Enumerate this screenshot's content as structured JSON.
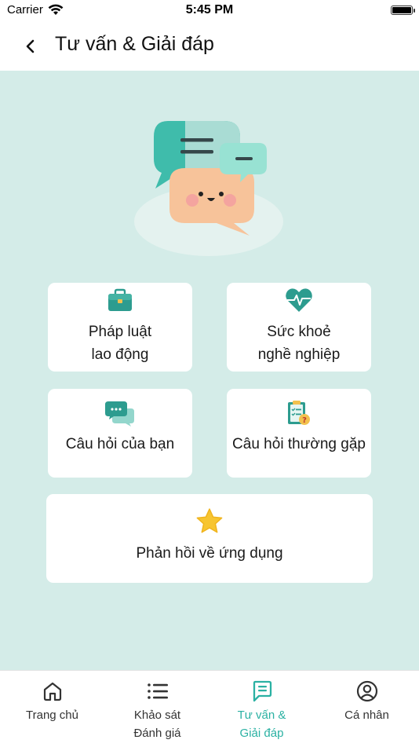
{
  "status": {
    "carrier": "Carrier",
    "time": "5:45 PM"
  },
  "header": {
    "title": "Tư vấn & Giải đáp"
  },
  "cards": [
    {
      "label": "Pháp luật\nlao động",
      "icon": "briefcase-icon"
    },
    {
      "label": "Sức khoẻ\nnghề nghiệp",
      "icon": "heart-pulse-icon"
    },
    {
      "label": "Câu hỏi của bạn",
      "icon": "chat-bubbles-icon"
    },
    {
      "label": "Câu hỏi thường gặp",
      "icon": "faq-clipboard-icon"
    },
    {
      "label": "Phản hồi về ứng dụng",
      "icon": "star-icon"
    }
  ],
  "tabs": [
    {
      "label": "Trang chủ",
      "icon": "home-icon"
    },
    {
      "label": "Khảo sát\nĐánh giá",
      "icon": "list-icon"
    },
    {
      "label": "Tư vấn &\nGiải đáp",
      "icon": "message-icon",
      "active": true
    },
    {
      "label": "Cá nhân",
      "icon": "user-circle-icon"
    }
  ],
  "colors": {
    "accent": "#2bb1a3",
    "background": "#d4ece8",
    "teal": "#3fbcab",
    "peach": "#f7c39a"
  }
}
